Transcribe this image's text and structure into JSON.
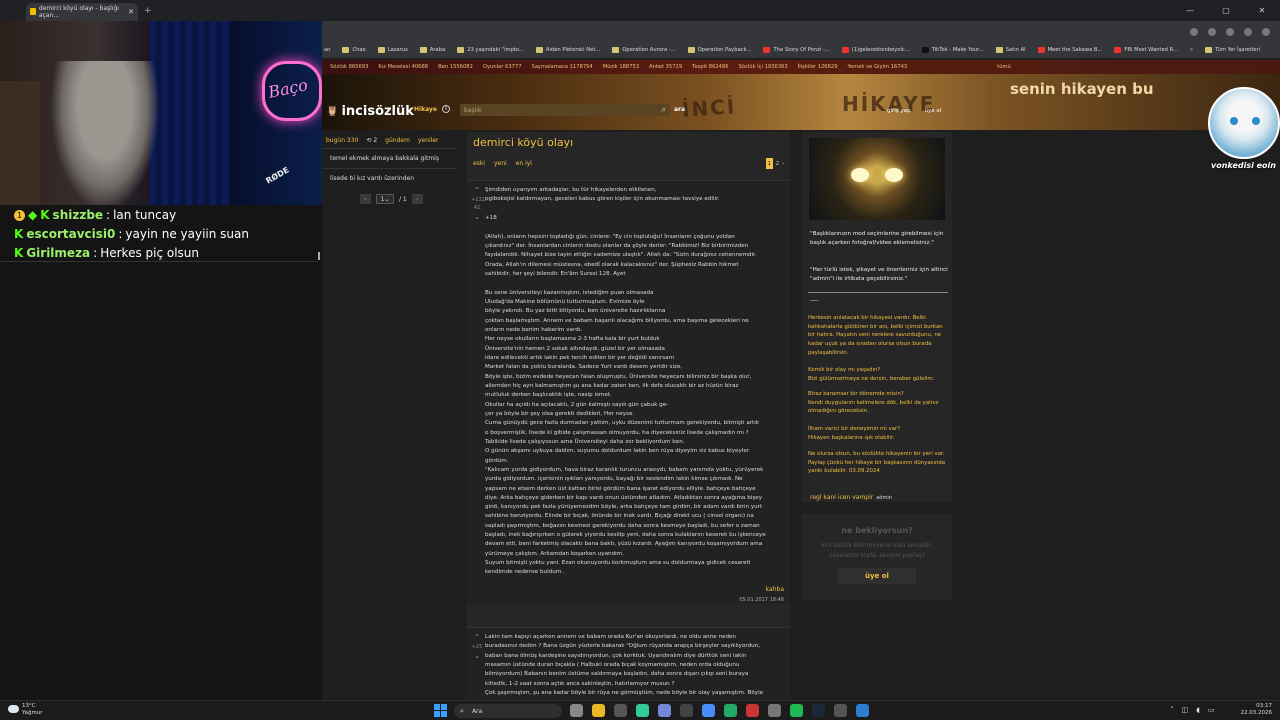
{
  "browser": {
    "tab_title": "demirci köyü olayı - başlığı açan...",
    "bookmarks": [
      "an",
      "Chao",
      "Lazarus",
      "Araba",
      "23 yaşındaki \"impto...",
      "Aiden Pleterski Net...",
      "Operation Aurora -...",
      "Operation Payback...",
      "The Story Of Ponzi -...",
      "(1)gelecektenbeyolc...",
      "TikTok - Make Your...",
      "Satın Al",
      "Meet the Sakawa B...",
      "FBI Most Wanted R..."
    ],
    "all_bookmarks": "Tüm Yer İşaretleri"
  },
  "stream": {
    "sign": "Baço",
    "mic": "RØDE",
    "chat": [
      {
        "badge": "1",
        "user": "shizzbe",
        "text": "lan tuncay"
      },
      {
        "badge": "",
        "user": "escortavcisi0",
        "text": "yayin ne yayiin suan"
      },
      {
        "badge": "",
        "user": "Girilmeza",
        "text": "Herkes piç olsun"
      }
    ]
  },
  "site": {
    "stats": [
      "Sözlük 865693",
      "Kız Meselesi 40688",
      "Ben 1556082",
      "Oyunlar 63777",
      "Saçmalamaca 1178754",
      "Müzik 188753",
      "Anket 35729",
      "Tespit 862486",
      "Sözlük İçi 1936363",
      "İlişkiler 126629",
      "Yemek ve Giyim 16743",
      "tümü"
    ],
    "banner_words": [
      "İNCİ",
      "HİKAYE",
      "senin hikayen bu"
    ],
    "logo": "incisözlük",
    "section": "Hikaye",
    "search_placeholder": "başlık",
    "search_button": "ara",
    "login": "giriş yap",
    "signup": "üye ol",
    "left": {
      "today": "bugün 330",
      "refresh": "2",
      "agenda": "gündem",
      "new": "yeniler",
      "items": [
        "temel ekmek almaya bakkala gitmiş",
        "lisede bi kız vardı üzerinden"
      ],
      "page": "1",
      "pages": "/ 1"
    },
    "title": {
      "text": "demirci köyü olayı",
      "sort": [
        "eski",
        "yeni",
        "en iyi"
      ],
      "pages": [
        "1",
        "2",
        "›"
      ]
    },
    "entries": [
      {
        "votes": "+132",
        "score": "42",
        "text": "Şimdiden uyarıyım arkadaşlar, bu tür hikayelerden etkilenen,\npgibokojisi kaldırmayan, geceleri kabus gören kişiler için okunmaması tavsiye edilir.\n\n+18\n\n(Allah), onların hepsini topladığı gün, cinlere: \"Ey cin topluluğu! İnsanların çoğunu yoldan\nçıkardınız\" der. İnsanlardan cinlerin dostu olanlar da şöyle derler: \"Rabbimiz! Biz birbirimizden\nfaydalandık. Nihayet bize tayin ettiğin vademize ulaştık\". Allah da: \"Sizin durağınız cehennemdir.\nOrada, Allah'ın dilemesi müstesna, ebedî olarak kalacaksınız\" der. Şüphesiz Rabbin hikmet\nsahibidir, her şeyi bilendir. En'âm Suresi 128. Ayet\n\nBu sene üniversiteyi kazanmıştım, istediğim puan olmasada\nUludağ'da Makine bölümünü tutturmuştum. Evimize öyle\nböyle yakındı. Bu yaz bitti bitiyordu, ben üniversite hazırlıklarına\nçoktan başlamıştım. Annem ve babam başarılı olacağımı biliyordu, ama başıma gelecekleri ne\nonların nede benim haberim vardı.\nHer neyse okulların başlamasına 2-3 hafta kala bir yurt bulduk\nÜniversite'nin hemen 2 sokak altındaydı, güzel bir yer olmasada\nidare edilecekti artık lakin pek tercih edilen bir yer değildi sanırsam\nMarket falan da yoktu buralarda. Sadece Yurt vardı desem yeridir size,\nBöyle işte, bizim evdede heyecan falan oluşmuştu, Üniversite heyecanı bilirsiniz bir başka olur,\nailemden hiç ayrı kalmamıştım şu ana kadar zaten ben, ilk defa olucaktı bir az hüzün biraz\nmutluluk derken başlıcaktık işte, nasip ismet.\nOkullar ha açıldı ha açılacaktı, 2 gün kalmıştı sayılı gün çabuk ge-\nçer ya böyle bir şey olsa gerekti dedikleri, Her neyse.\nCuma günüydü gece fazla durmadan yattım, uyku düzenimi tutturmam gerekiyordu, bitmişti artık\no boşvermişlik, lisede ki gibide çalışmassan olmuyordu, ha diyeceksiniz lisede çalışmadın mı ?\nTabikide lisede çalışıyosun ama Üniversiteyi daha zor bekliyordum ben.\nO günün akşamı uykuya daldım, suyumu doldurdum lakin ben rüya diyeyim siz kabus biyeyler\ngördüm.\n\"Kalıcam yurda gidiyordum, hava biraz karanlık turuncu arasıydı, babam yanımda yoktu, yürüyerek\nyurda gidiyordum. içerisinin ışıkları yanıyordu, bayağı bir seslendim lakin kimse çıkmadı. Ne\nyapsam ne etsem derken üst kattan birisi gördüm bana işaret ediyordu elliyle. bahçeye bahçeye\ndiye. Arka bahçeye giderken bir kapı vardı onun üstünden atladım. Atladıktan sonra ayağıma bişey\ngirdi, kanıyordu pek fazla yürüyemezdim böyle, arka bahçeye tam girdim, bir adam vardı birin yurt\nsahibine benziyordu. Elinde bir bıçak, önünde bir inek vardı. Bıçağı direkt ucu ( cinsel organı) na\nsapladı şaşırmıştım, boğazını kesmesi gerekiyordu daha sonra kesmeye başladı, bu sefer o zaman\nbaşladı, inek bağırışırken o gülerek yiyordu kesilip yeni, daha sonra kulaklarını keserek bu işkenceye\ndevam etti, beni farketmiş olacaktı bana baktı, yüzü kızardı. Ayağım kanıyordu koşamıyordum ama\nyürümeye çalıştım. Arkamdan koşarken uyandım.\nSuyum bitmişti yoktu yani. Ezan okunuyordu korkmuştum ama su doldurmaya gidicek cesareti\nkendimde nedense buldum.",
        "author": "kahba",
        "date": "05.01.2017 18:48"
      },
      {
        "votes": "+25",
        "score": "",
        "text": "Lakin tam kapıyı açarken annem ve babam orada Kur'an okuyorlardı, ne oldu anne neden\nburadasınız dedim ? Bana üzgün yüzlerle bakarak \"Oğlum rüyanda arapça birşeyler sayıklıyordun,\nbaban bana ölmüş kardeşine sayıdınıyordun, çok korktuk. Uyandıralım diye dürttük seni lakin\nmasamın üstünde duran bıçakla ( Halbuki orada bıçak koymamıştım, neden orda olduğunu\nbilmiyordum) Babanın benim üstüme saldırmaya başladın, daha sonra dışarı çıkıp seni buraya\nkitledik, 1-2 saat sonra açtık anca sakinleştin, hatırlamıyor musun ?\nÇok şaşırmıştım, şu ana kadar böyle bir rüya ne görmüştüm, nede böyle bir olay yaşamıştım. Böyle"
      }
    ],
    "right": {
      "quote1": "\"Başlıklarınızın mod seçimlerine girebilmesi için başlık açarken fotoğraf/video eklemelisiniz.\"",
      "quote2": "\"Her türlü istek, şikayet ve önerileriniz için altinci \"admin\"i ile irtibata geçebilirsiniz.\"",
      "dash": "___",
      "gold": [
        "Herkesin anlatacak bir hikayesi vardır. Belki kahkahalarla güldüren bir anı, belki içimizi burkan bir hatıra. Hayatın seni nerelere savurduğunu, ne kadar uçuk ya da sıradan olursa olsun burada paylaşabilirsin.",
        "Komik bir olay mı yaşadın?\nBizi gülümsetmeye ne dersin, beraber gülelim.",
        "Biraz karamsar bir dönemde misin?\nKendi duygularını kelimelere dök, belki de yalnız olmadığını göreceksin.",
        "İlham verici bir deneyimin mi var?\nHikayen başkalarına ışık olabilir.",
        "Ne olursa olsun, bu sözlükte hikayenin bir yeri var. Paylaş çünkü her hikaye bir başkasının dünyasında yankı bulabilir. 03.09.2024"
      ],
      "footer_author": "regl kani icen vampir",
      "footer_role": "admin",
      "box_title": "ne bekliyorsun?",
      "box_text": "inci sözlük bilinmeyene olan sevgidir, cesaretini topla, sevgini paylaş!",
      "box_button": "üye ol"
    }
  },
  "avatar_name": "vonkedisi eoin",
  "taskbar": {
    "temp": "13°C",
    "weather": "Yağmur",
    "search": "Ara",
    "time": "03:17",
    "date": "22.03.2026"
  }
}
